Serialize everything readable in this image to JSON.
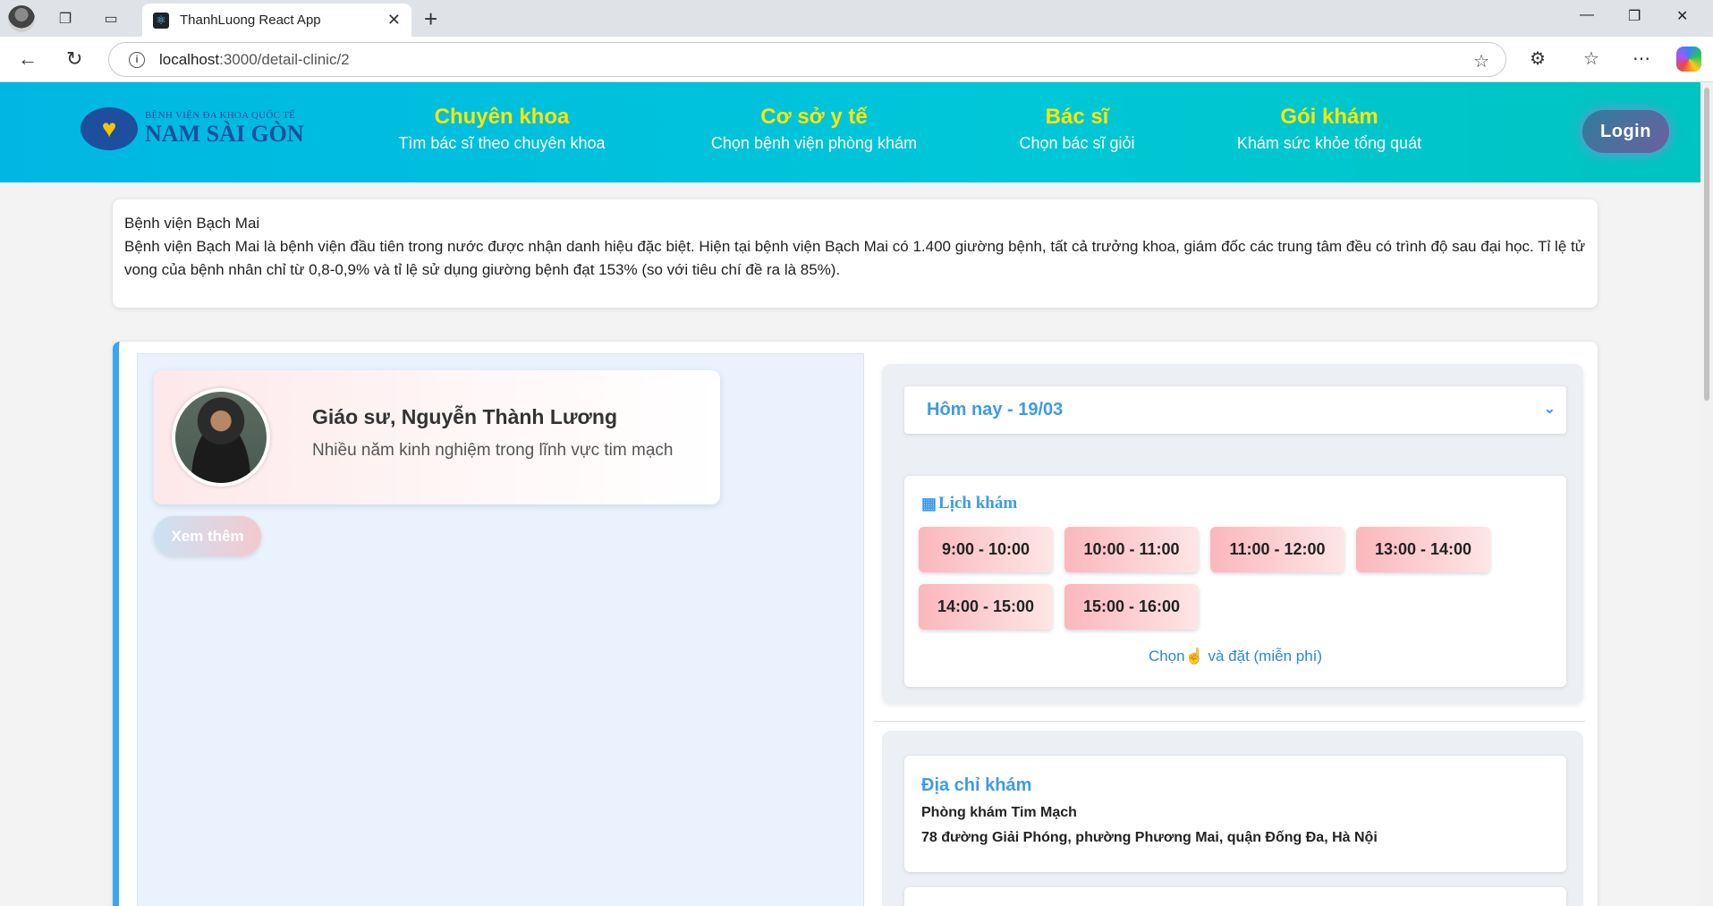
{
  "browser": {
    "tab_title": "ThanhLuong React App",
    "url_host": "localhost",
    "url_path": ":3000/detail-clinic/2"
  },
  "header": {
    "logo_small": "BỆNH VIỆN ĐA KHOA QUỐC TẾ",
    "logo_big": "NAM SÀI GÒN",
    "menu": [
      {
        "title": "Chuyên khoa",
        "sub": "Tìm bác sĩ theo chuyên khoa"
      },
      {
        "title": "Cơ sở y tế",
        "sub": "Chọn bệnh viện phòng khám"
      },
      {
        "title": "Bác sĩ",
        "sub": "Chọn bác sĩ giỏi"
      },
      {
        "title": "Gói khám",
        "sub": "Khám sức khỏe tổng quát"
      }
    ],
    "login_label": "Login"
  },
  "clinic": {
    "name": "Bệnh viện Bạch Mai",
    "description": "Bệnh viện Bạch Mai là bệnh viện đầu tiên trong nước được nhận danh hiệu đặc biệt. Hiện tại bệnh viện Bạch Mai có 1.400 giường bệnh, tất cả trưởng khoa, giám đốc các trung tâm đều có trình độ sau đại học. Tỉ lệ tử vong của bệnh nhân chỉ từ 0,8-0,9% và tỉ lệ sử dụng giường bệnh đạt 153% (so với tiêu chí đề ra là 85%)."
  },
  "doctor": {
    "name": "Giáo sư, Nguyễn Thành Lương",
    "description": "Nhiều năm kinh nghiệm trong lĩnh vực tim mạch",
    "more_label": "Xem thêm"
  },
  "schedule": {
    "selected_day": "Hôm nay - 19/03",
    "title": "Lịch khám",
    "slots": [
      "9:00 - 10:00",
      "10:00 - 11:00",
      "11:00 - 12:00",
      "13:00 - 14:00",
      "14:00 - 15:00",
      "15:00 - 16:00"
    ],
    "note_before": "Chọn",
    "note_after": " và đặt (miễn phí)"
  },
  "address": {
    "title": "Địa chỉ khám",
    "clinic_name": "Phòng khám Tim Mạch",
    "street": "78 đường Giải Phóng, phường Phương Mai, quận Đống Đa, Hà Nội"
  },
  "colors": {
    "header_start": "#00b7e3",
    "header_end": "#00c4c0",
    "menu_title": "#ffe600",
    "accent_blue": "#3d9be9",
    "slot_pink": "#fbb7bc"
  },
  "icons": {
    "calendar": "calendar-icon",
    "hand": "pointing-hand-icon",
    "chevron": "chevron-down-icon"
  }
}
